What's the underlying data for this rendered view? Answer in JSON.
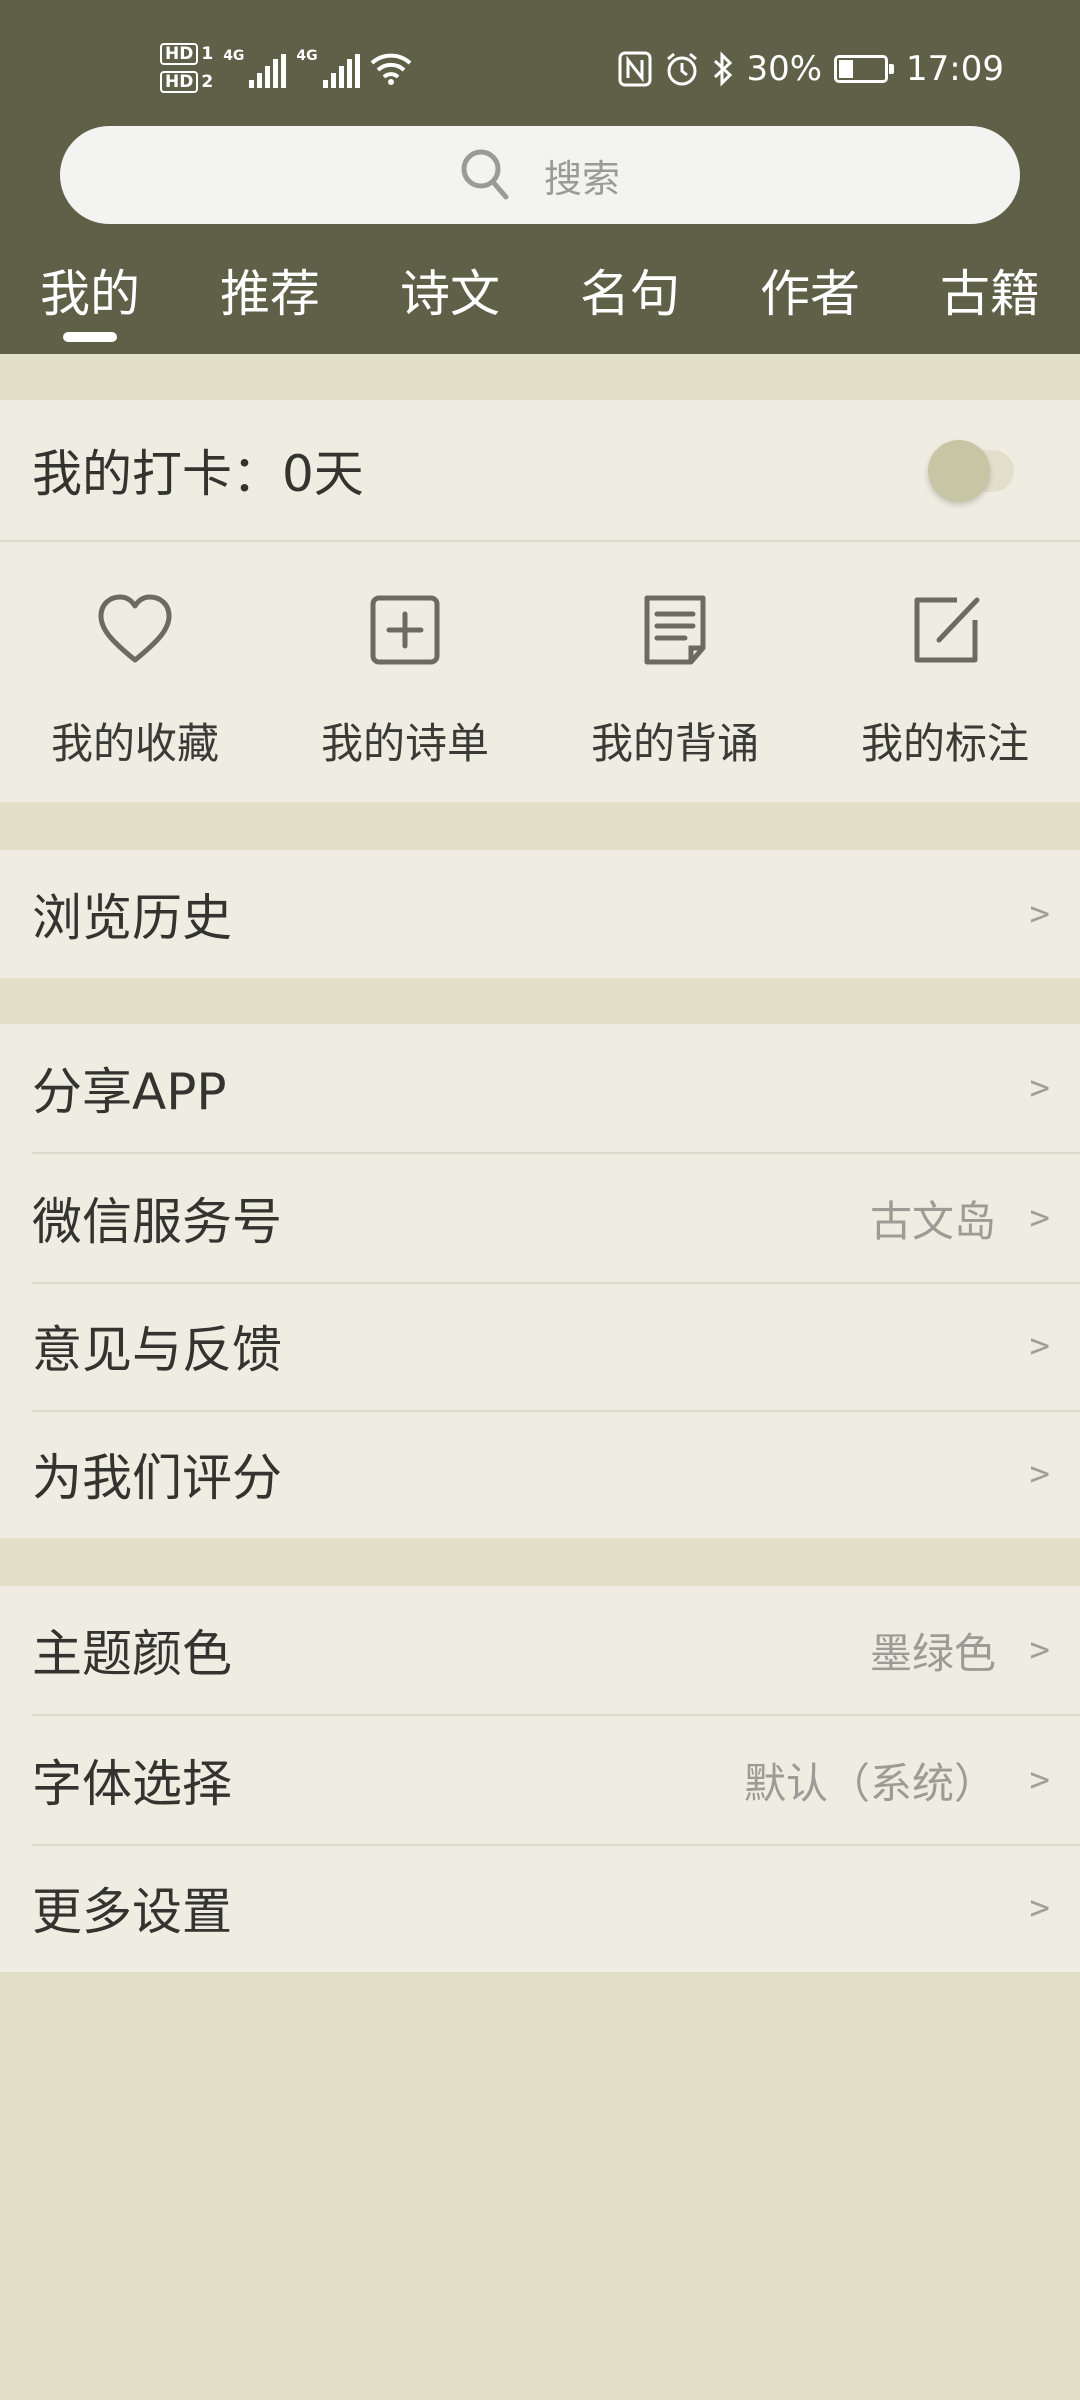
{
  "status_bar": {
    "hd1": "HD",
    "hd1_sub": "1",
    "hd2": "HD",
    "hd2_sub": "2",
    "net1": "4G",
    "net2": "4G",
    "nfc_icon": "nfc-icon",
    "alarm_icon": "alarm-icon",
    "bluetooth_icon": "bluetooth-icon",
    "battery_pct": "30%",
    "time": "17:09"
  },
  "search": {
    "placeholder": "搜索",
    "icon": "search-icon"
  },
  "tabs": [
    {
      "label": "我的",
      "active": true
    },
    {
      "label": "推荐"
    },
    {
      "label": "诗文"
    },
    {
      "label": "名句"
    },
    {
      "label": "作者"
    },
    {
      "label": "古籍"
    }
  ],
  "checkin": {
    "label": "我的打卡：0天",
    "toggle_on": false
  },
  "quick_actions": [
    {
      "label": "我的收藏",
      "icon": "heart-icon"
    },
    {
      "label": "我的诗单",
      "icon": "add-square-icon"
    },
    {
      "label": "我的背诵",
      "icon": "document-icon"
    },
    {
      "label": "我的标注",
      "icon": "edit-icon"
    }
  ],
  "history": {
    "label": "浏览历史",
    "chevron": ">"
  },
  "group2": [
    {
      "label": "分享APP",
      "value": "",
      "chevron": ">"
    },
    {
      "label": "微信服务号",
      "value": "古文岛",
      "chevron": ">"
    },
    {
      "label": "意见与反馈",
      "value": "",
      "chevron": ">"
    },
    {
      "label": "为我们评分",
      "value": "",
      "chevron": ">"
    }
  ],
  "group3": [
    {
      "label": "主题颜色",
      "value": "墨绿色",
      "chevron": ">"
    },
    {
      "label": "字体选择",
      "value": "默认（系统）",
      "chevron": ">"
    },
    {
      "label": "更多设置",
      "value": "",
      "chevron": ">"
    }
  ],
  "colors": {
    "header": "#5E6048",
    "background": "#E1DFC6",
    "card": "#EFEDE1"
  }
}
